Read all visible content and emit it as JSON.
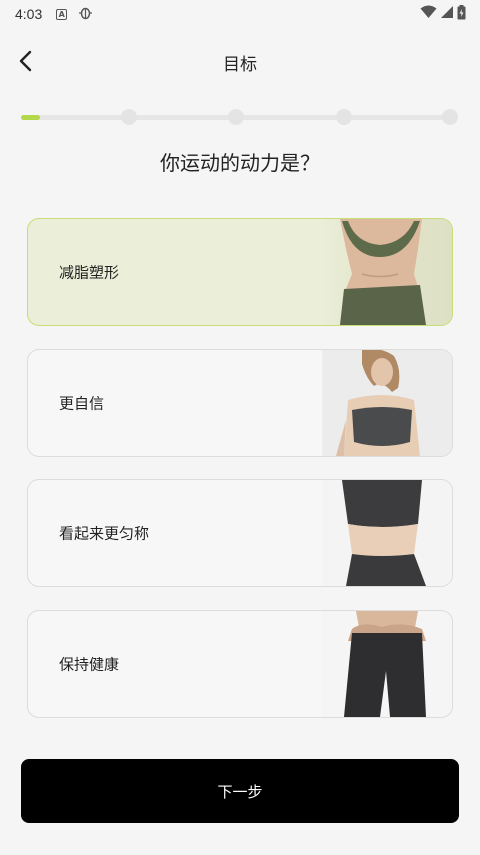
{
  "status_bar": {
    "time": "4:03",
    "notification_icons": [
      "a-box-icon",
      "bug-icon"
    ],
    "right_icons": [
      "wifi-icon",
      "signal-icon",
      "battery-charging-icon"
    ]
  },
  "header": {
    "title": "目标",
    "back_icon": "chevron-left-icon"
  },
  "progress": {
    "total_steps": 5,
    "current_step": 1
  },
  "question": "你运动的动力是？",
  "options": [
    {
      "label": "减脂塑形",
      "selected": true,
      "image": "toned-abs-photo"
    },
    {
      "label": "更自信",
      "selected": false,
      "image": "confident-woman-photo"
    },
    {
      "label": "看起来更匀称",
      "selected": false,
      "image": "slim-waist-photo"
    },
    {
      "label": "保持健康",
      "selected": false,
      "image": "leggings-photo"
    }
  ],
  "next_button": {
    "label": "下一步"
  },
  "colors": {
    "accent": "#b3d94a",
    "selected_bg": "#ebeed8",
    "button_bg": "#000000"
  }
}
